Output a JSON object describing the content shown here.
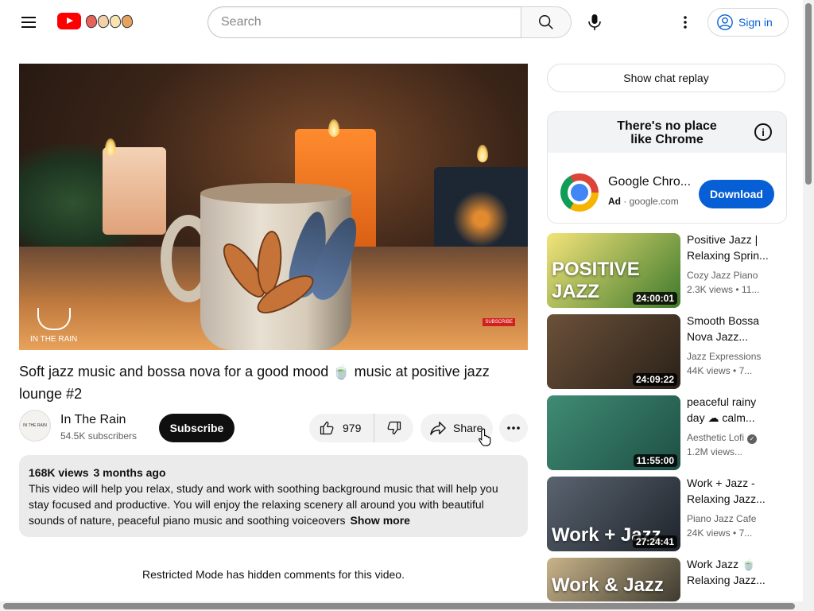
{
  "header": {
    "search_placeholder": "Search",
    "sign_in": "Sign in"
  },
  "video": {
    "title": "Soft jazz music and bossa nova for a good mood 🍵 music at positive jazz lounge #2",
    "channel_name": "In The Rain",
    "subscribers": "54.5K subscribers",
    "subscribe_label": "Subscribe",
    "likes": "979",
    "share_label": "Share",
    "player_brand": "IN THE RAIN",
    "player_badge": "SUBSCRIBE",
    "channel_avatar_text": "IN THE RAIN"
  },
  "description": {
    "views": "168K views",
    "age": "3 months ago",
    "text": "This video will help you relax, study and work with soothing background music that will help you stay focused and productive. You will enjoy the relaxing scenery all around you with beautiful sounds of nature, peaceful piano music and soothing voiceovers",
    "show_more": "Show more"
  },
  "comments": {
    "restricted": "Restricted Mode has hidden comments for this video."
  },
  "sidebar": {
    "chat_replay": "Show chat replay",
    "ad": {
      "banner": "There's no place like Chrome",
      "title": "Google Chro...",
      "badge": "Ad",
      "domain": "google.com",
      "button": "Download"
    },
    "recommendations": [
      {
        "title": "Positive Jazz | Relaxing Sprin...",
        "channel": "Cozy Jazz Piano",
        "views": "2.3K views",
        "age": "11...",
        "duration": "24:00:01",
        "thumb_text": "POSITIVE JAZZ",
        "thumb_colors": [
          "#f3e47a",
          "#3f7a2c"
        ]
      },
      {
        "title": "Smooth Bossa Nova Jazz...",
        "channel": "Jazz Expressions",
        "views": "44K views",
        "age": "7...",
        "duration": "24:09:22",
        "thumb_text": "",
        "thumb_colors": [
          "#6b5139",
          "#2a2119"
        ]
      },
      {
        "title": "peaceful rainy day ☁ calm...",
        "channel": "Aesthetic Lofi",
        "views": "1.2M views...",
        "age": "",
        "duration": "11:55:00",
        "thumb_text": "",
        "thumb_colors": [
          "#3f8c73",
          "#1e4f45"
        ],
        "verified": true
      },
      {
        "title": "Work + Jazz - Relaxing Jazz...",
        "channel": "Piano Jazz Cafe",
        "views": "24K views",
        "age": "7...",
        "duration": "27:24:41",
        "thumb_text": "Work + Jazz",
        "thumb_colors": [
          "#5a6470",
          "#1f242b"
        ]
      },
      {
        "title": "Work Jazz 🍵 Relaxing Jazz...",
        "channel": "",
        "views": "",
        "age": "",
        "duration": "",
        "thumb_text": "Work & Jazz",
        "thumb_colors": [
          "#c9b48a",
          "#3d3a2f"
        ]
      }
    ]
  }
}
